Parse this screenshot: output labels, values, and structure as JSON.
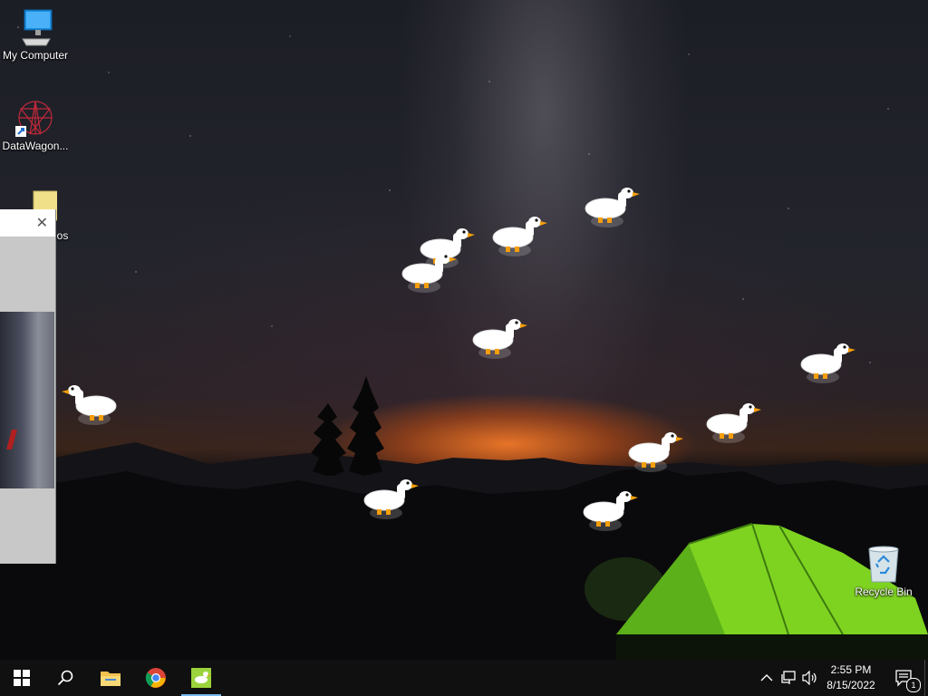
{
  "desktop_icons": {
    "my_computer": "My Computer",
    "datawagon": "DataWagon...",
    "partial_icon": "os",
    "recycle_bin": "Recycle Bin"
  },
  "window": {
    "close_glyph": "✕"
  },
  "taskbar": {
    "start_icon": "windows-logo",
    "search_icon": "magnifier",
    "pinned": [
      "file-explorer",
      "chrome",
      "desktop-goose"
    ],
    "clock_time": "2:55 PM",
    "clock_date": "8/15/2022",
    "notification_count": "1"
  },
  "colors": {
    "taskbar_bg": "#101010",
    "accent": "#76b9ed",
    "tent": "#7ed321"
  }
}
